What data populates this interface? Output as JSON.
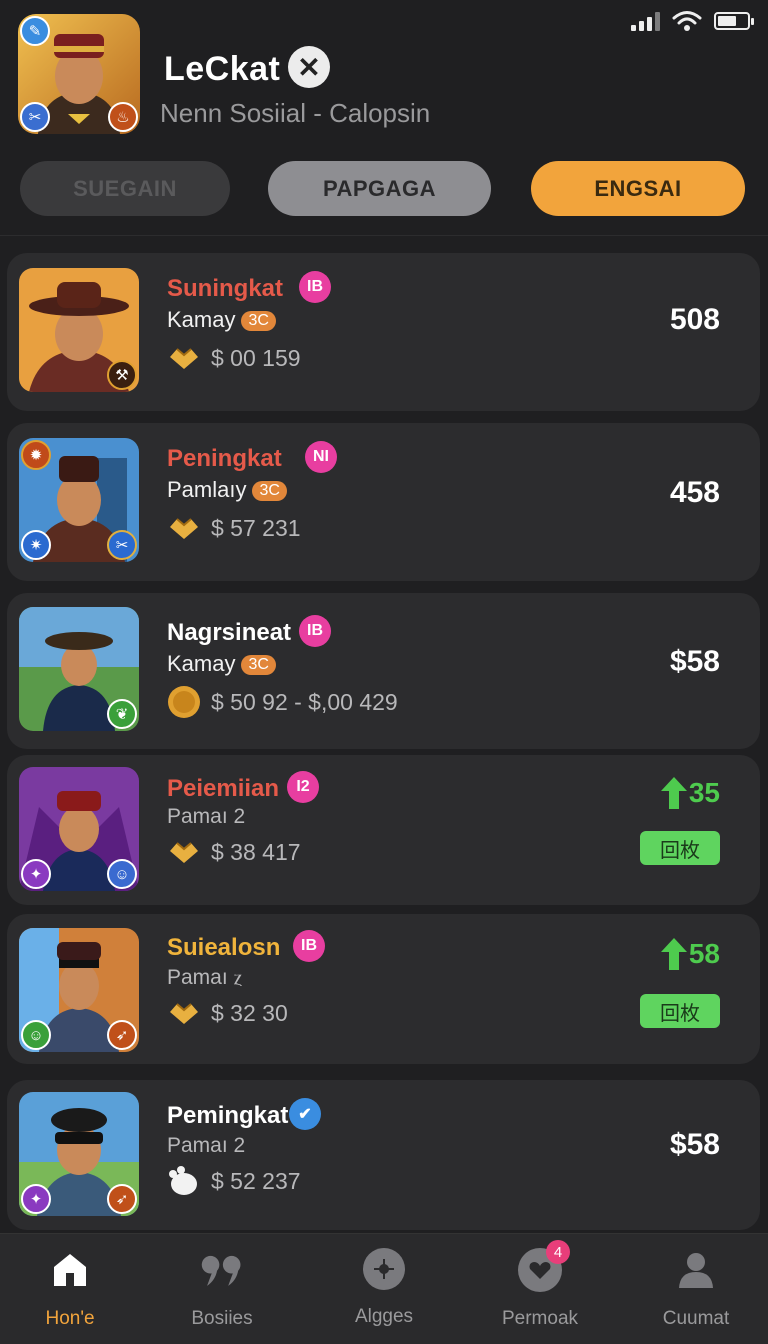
{
  "status_bar": {
    "signal": "signal-icon",
    "wifi": "wifi-icon",
    "battery": "battery-icon"
  },
  "header": {
    "title": "LeCkat",
    "subtitle": "Nenn Sosiial - Calopsin",
    "avatar": "agent-avatar",
    "close_icon": "close-icon"
  },
  "tabs": [
    {
      "label": "SUEGAIN"
    },
    {
      "label": "PAPGAGA"
    },
    {
      "label": "ENGSAI"
    }
  ],
  "list": [
    {
      "name": "Suningkat",
      "name_color": "#e55a4a",
      "badge": "IB",
      "sub": "Kamay",
      "level": "3C",
      "price_icon": "gift-icon",
      "price": "$ 00 159",
      "value": "508"
    },
    {
      "name": "Peningkat",
      "name_color": "#e55a4a",
      "badge": "NI",
      "sub": "Pamlaıy",
      "level": "3C",
      "price_icon": "gift-icon",
      "price": "$ 57 231",
      "value": "458"
    },
    {
      "name": "Nagrsineat",
      "name_color": "#ffffff",
      "badge": "IB",
      "sub": "Kamay",
      "level": "3C",
      "price_icon": "coin-icon",
      "price": "$ 50 92 - $,00 429",
      "value": "$58"
    },
    {
      "name": "Peiemiian",
      "name_color": "#e55a4a",
      "badge": "I2",
      "sub": "Pamaı 2",
      "price_icon": "gift-icon",
      "price": "$ 38 417",
      "change": "35",
      "tag": "回枚"
    },
    {
      "name": "Suiealosn",
      "name_color": "#f0b43c",
      "badge": "IB",
      "sub": "Pamaı ⲍ",
      "price_icon": "gift-icon",
      "price": "$ 32 30",
      "change": "58",
      "tag": "回枚"
    },
    {
      "name": "Pemingkat",
      "name_color": "#ffffff",
      "badge_icon": "verified-icon",
      "sub": "Pamaı 2",
      "price_icon": "paw-icon",
      "price": "$ 52 237",
      "value": "$58"
    }
  ],
  "nav": [
    {
      "label": "Hon'e",
      "icon": "home-icon"
    },
    {
      "label": "Bosiies",
      "icon": "quote-icon"
    },
    {
      "label": "Algges",
      "icon": "settings-icon"
    },
    {
      "label": "Permoak",
      "icon": "heart-icon",
      "count": "4"
    },
    {
      "label": "Cuumat",
      "icon": "user-icon"
    }
  ],
  "colors": {
    "accent": "#f2a43c",
    "positive": "#4ecb4e",
    "background": "#1f1f21",
    "card": "#2c2c2e"
  }
}
